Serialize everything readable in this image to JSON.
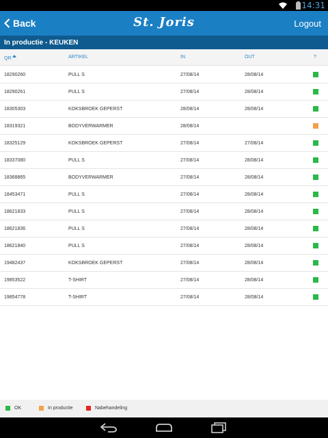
{
  "status_bar": {
    "time": "14:31"
  },
  "header": {
    "back_label": "Back",
    "title": "St. Joris",
    "logout_label": "Logout"
  },
  "sub_header": {
    "title": "In productie - KEUKEN"
  },
  "colors": {
    "ok": "#2ab849",
    "in_productie": "#f2a14b",
    "nabehandeling": "#e52521"
  },
  "table": {
    "columns": {
      "qr": "QR",
      "artikel": "ARTIKEL",
      "in": "IN",
      "out": "OUT",
      "status": "?"
    },
    "rows": [
      {
        "qr": "18290260",
        "artikel": "PULL S",
        "in": "27/08/14",
        "out": "28/08/14",
        "status": "ok"
      },
      {
        "qr": "18290261",
        "artikel": "PULL S",
        "in": "27/08/14",
        "out": "28/08/14",
        "status": "ok"
      },
      {
        "qr": "18305303",
        "artikel": "KOKSBROEK GEPERST",
        "in": "28/08/14",
        "out": "28/08/14",
        "status": "ok"
      },
      {
        "qr": "18319321",
        "artikel": "BODYVERWARMER",
        "in": "28/08/14",
        "out": "",
        "status": "in_productie"
      },
      {
        "qr": "18325129",
        "artikel": "KOKSBROEK GEPERST",
        "in": "27/08/14",
        "out": "27/08/14",
        "status": "ok"
      },
      {
        "qr": "18337080",
        "artikel": "PULL S",
        "in": "27/08/14",
        "out": "28/08/14",
        "status": "ok"
      },
      {
        "qr": "18368865",
        "artikel": "BODYVERWARMER",
        "in": "27/08/14",
        "out": "28/08/14",
        "status": "ok"
      },
      {
        "qr": "18453471",
        "artikel": "PULL S",
        "in": "27/08/14",
        "out": "28/08/14",
        "status": "ok"
      },
      {
        "qr": "18621833",
        "artikel": "PULL S",
        "in": "27/08/14",
        "out": "28/08/14",
        "status": "ok"
      },
      {
        "qr": "18621836",
        "artikel": "PULL S",
        "in": "27/08/14",
        "out": "28/08/14",
        "status": "ok"
      },
      {
        "qr": "18621840",
        "artikel": "PULL S",
        "in": "27/08/14",
        "out": "28/08/14",
        "status": "ok"
      },
      {
        "qr": "19482437",
        "artikel": "KOKSBROEK GEPERST",
        "in": "27/08/14",
        "out": "28/08/14",
        "status": "ok"
      },
      {
        "qr": "19853522",
        "artikel": "T-SHIRT",
        "in": "27/08/14",
        "out": "28/08/14",
        "status": "ok"
      },
      {
        "qr": "19854778",
        "artikel": "T-SHIRT",
        "in": "27/08/14",
        "out": "28/08/14",
        "status": "ok"
      }
    ]
  },
  "legend": {
    "ok": "OK",
    "in_productie": "In productie",
    "nabehandeling": "Nabehandeling"
  },
  "nav": {
    "back_icon": "back-arrow-icon",
    "home_icon": "home-icon",
    "recents_icon": "recent-apps-icon"
  }
}
